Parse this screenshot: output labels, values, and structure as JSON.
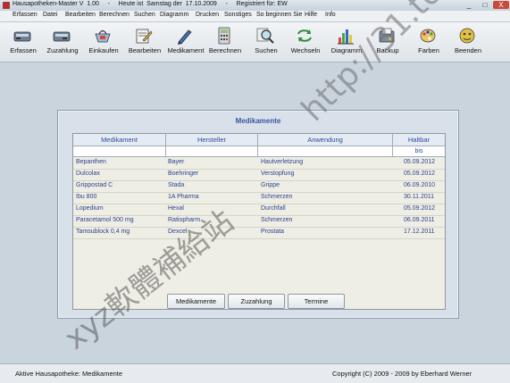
{
  "window": {
    "title": "Hausapotheken-Master V  1.00     -     Heute ist  Samstag der  17.10.2009     -     Registriert für: EW",
    "buttons": [
      "_",
      "□",
      "X"
    ]
  },
  "menu": [
    "Erfassen",
    "Datei",
    "Bearbeiten",
    "Berechnen",
    "Suchen",
    "Diagramm",
    "Drucken",
    "Sonstiges",
    "So beginnen Sie",
    "Hilfe",
    "Info"
  ],
  "toolbar": [
    {
      "label": "Erfassen",
      "icon": "scanner-icon"
    },
    {
      "label": "Zuzahlung",
      "icon": "scanner-icon"
    },
    {
      "label": "Einkaufen",
      "icon": "basket-icon"
    },
    {
      "label": "Bearbeiten",
      "icon": "pencil-paper-icon"
    },
    {
      "label": "Medikament",
      "icon": "pen-icon"
    },
    {
      "label": "Berechnen",
      "icon": "calculator-icon"
    },
    {
      "label": "Suchen",
      "icon": "magnifier-icon"
    },
    {
      "label": "Wechseln",
      "icon": "exchange-icon"
    },
    {
      "label": "Diagramm",
      "icon": "bar-chart-icon"
    },
    {
      "label": "Backup",
      "icon": "backup-icon"
    },
    {
      "label": "Farben",
      "icon": "palette-icon"
    },
    {
      "label": "Beenden",
      "icon": "exit-icon"
    }
  ],
  "panel": {
    "title": "Medikamente",
    "columns": [
      "Medikament",
      "Hersteller",
      "Anwendung",
      "Haltbar"
    ],
    "filter_hint": "bis",
    "rows": [
      [
        "Bepanthen",
        "Bayer",
        "Hautverletzung",
        "05.09.2012"
      ],
      [
        "Dulcolax",
        "Boehringer",
        "Verstopfung",
        "05.09.2012"
      ],
      [
        "Grippostad C",
        "Stada",
        "Grippe",
        "06.09.2010"
      ],
      [
        "Ibu 800",
        "1A Pharma",
        "Schmerzen",
        "30.11.2011"
      ],
      [
        "Lopedium",
        "Hexal",
        "Durchfall",
        "05.09.2012"
      ],
      [
        "Paracetamol 500 mg",
        "Ratiopharm",
        "Schmerzen",
        "06.09.2011"
      ],
      [
        "Tamsublock 0,4 mg",
        "Dexcel",
        "Prostata",
        "17.12.2011"
      ]
    ],
    "buttons": [
      "Medikamente",
      "Zuzahlung",
      "Termine"
    ]
  },
  "status": {
    "left": "Aktive Hausapotheke:  Medikamente",
    "right": "Copyright (C)  2009 - 2009 by Eberhard Werner"
  },
  "watermark": {
    "url": "http://31.to",
    "text": "xyz軟體補給站"
  },
  "colors": {
    "accent": "#3a54a0",
    "desk": "#c9d4dd",
    "grid_bg": "#efeee4"
  }
}
